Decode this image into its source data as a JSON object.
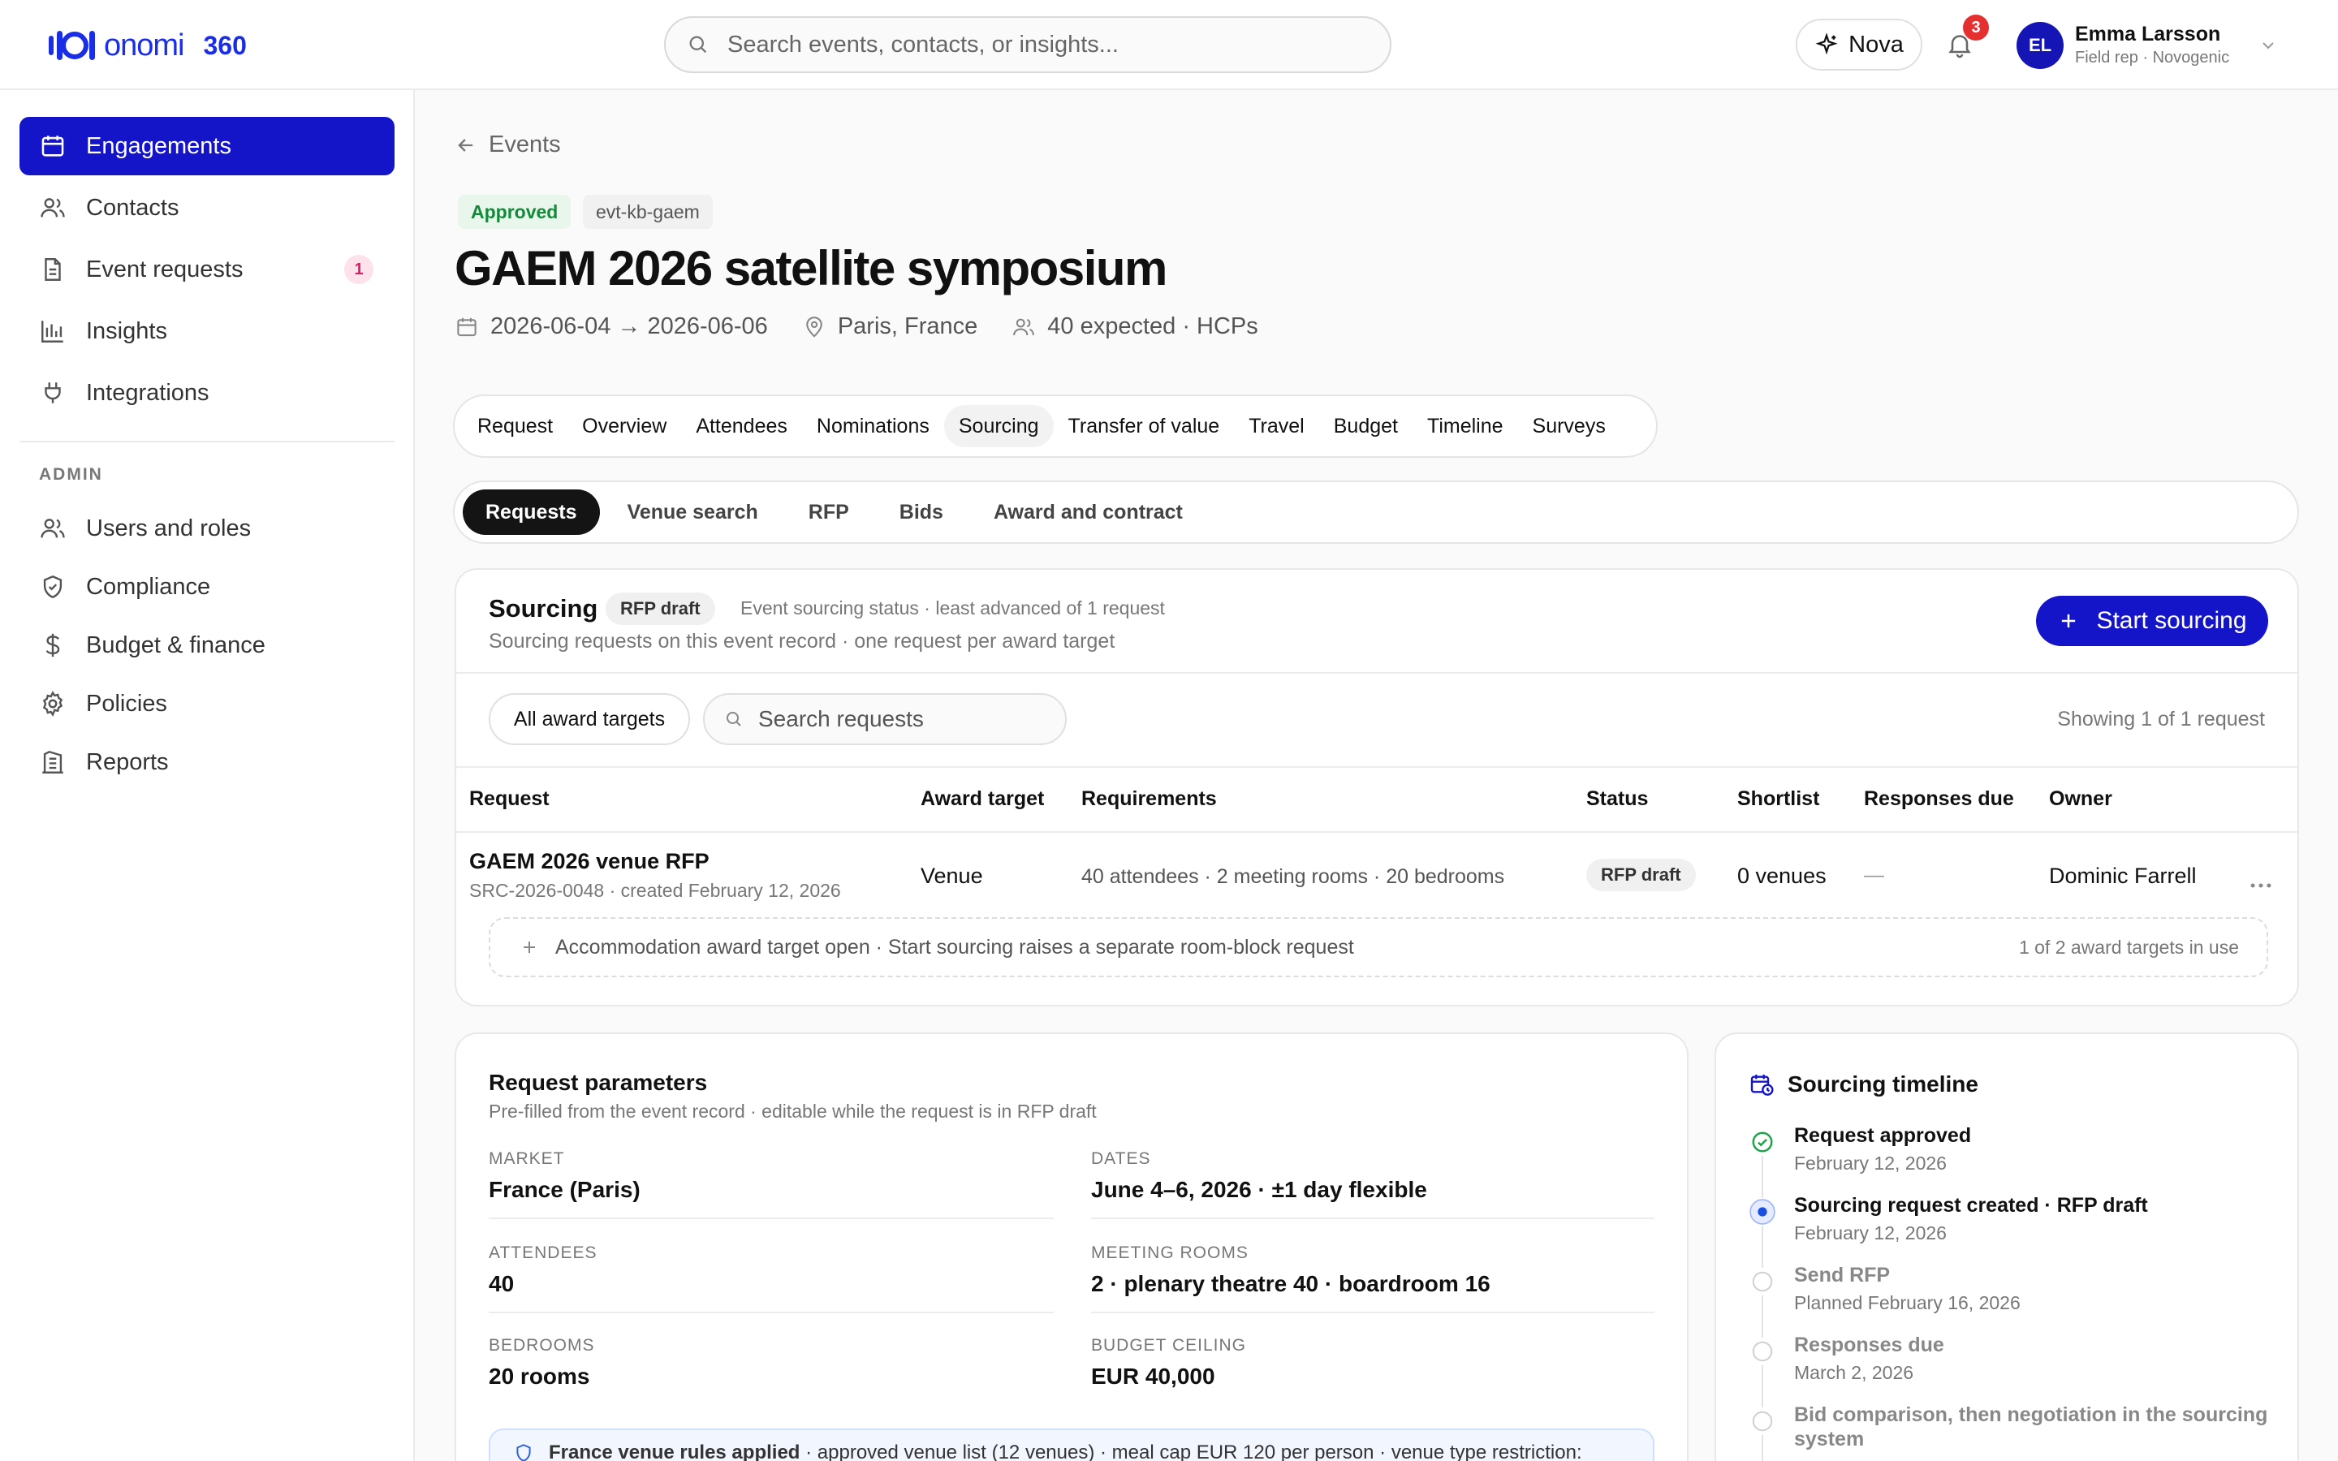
{
  "brand": {
    "name": "onomi",
    "suffix": "360",
    "accent": "#1414c8"
  },
  "search": {
    "placeholder": "Search events, contacts, or insights..."
  },
  "header": {
    "nova_label": "Nova",
    "notifications_count": "3",
    "user": {
      "initials": "EL",
      "name": "Emma Larsson",
      "role": "Field rep · Novogenic"
    }
  },
  "sidebar": {
    "items": [
      {
        "label": "Engagements",
        "icon": "calendar-icon",
        "active": true
      },
      {
        "label": "Contacts",
        "icon": "users-icon"
      },
      {
        "label": "Event requests",
        "icon": "document-icon",
        "badge": "1"
      },
      {
        "label": "Insights",
        "icon": "bar-chart-icon"
      },
      {
        "label": "Integrations",
        "icon": "plug-icon"
      }
    ],
    "admin_label": "ADMIN",
    "admin_items": [
      {
        "label": "Users and roles",
        "icon": "users-icon"
      },
      {
        "label": "Compliance",
        "icon": "shield-icon"
      },
      {
        "label": "Budget & finance",
        "icon": "dollar-icon"
      },
      {
        "label": "Policies",
        "icon": "gear-icon"
      },
      {
        "label": "Reports",
        "icon": "report-icon"
      }
    ]
  },
  "breadcrumb": {
    "label": "Events"
  },
  "event": {
    "status": "Approved",
    "id": "evt-kb-gaem",
    "title": "GAEM 2026 satellite symposium",
    "dates": "2026-06-04 → 2026-06-06",
    "location": "Paris, France",
    "audience": "40 expected · HCPs"
  },
  "tabs": [
    "Request",
    "Overview",
    "Attendees",
    "Nominations",
    "Sourcing",
    "Transfer of value",
    "Travel",
    "Budget",
    "Timeline",
    "Surveys"
  ],
  "active_tab": "Sourcing",
  "subtabs": [
    "Requests",
    "Venue search",
    "RFP",
    "Bids",
    "Award and contract"
  ],
  "active_subtab": "Requests",
  "sourcing": {
    "title": "Sourcing",
    "status_pill": "RFP draft",
    "status_note": "Event sourcing status · least advanced of 1 request",
    "subtitle": "Sourcing requests on this event record · one request per award target",
    "start_button": "Start sourcing",
    "filter_label": "All award targets",
    "search_placeholder": "Search requests",
    "showing": "Showing 1 of 1 request",
    "columns": [
      "Request",
      "Award target",
      "Requirements",
      "Status",
      "Shortlist",
      "Responses due",
      "Owner"
    ],
    "rows": [
      {
        "name": "GAEM 2026 venue RFP",
        "meta": "SRC-2026-0048 · created February 12, 2026",
        "award_target": "Venue",
        "requirements": "40 attendees · 2 meeting rooms · 20 bedrooms",
        "status": "RFP draft",
        "shortlist": "0 venues",
        "responses_due": "—",
        "owner": "Dominic Farrell"
      }
    ],
    "accommodation_note": "Accommodation award target open · Start sourcing raises a separate room-block request",
    "award_targets_in_use": "1 of 2 award targets in use"
  },
  "parameters": {
    "title": "Request parameters",
    "subtitle": "Pre-filled from the event record · editable while the request is in RFP draft",
    "fields": [
      {
        "label": "MARKET",
        "value": "France (Paris)"
      },
      {
        "label": "DATES",
        "value": "June 4–6, 2026 · ±1 day flexible"
      },
      {
        "label": "ATTENDEES",
        "value": "40"
      },
      {
        "label": "MEETING ROOMS",
        "value": "2 · plenary theatre 40 · boardroom 16"
      },
      {
        "label": "BEDROOMS",
        "value": "20 rooms"
      },
      {
        "label": "BUDGET CEILING",
        "value": "EUR 40,000"
      }
    ],
    "rules_bold": "France venue rules applied",
    "rules_text": " · approved venue list (12 venues) · meal cap EUR 120 per person · venue type restriction:"
  },
  "timeline": {
    "title": "Sourcing timeline",
    "items": [
      {
        "name": "Request approved",
        "date": "February 12, 2026",
        "state": "done"
      },
      {
        "name": "Sourcing request created · RFP draft",
        "date": "February 12, 2026",
        "state": "current"
      },
      {
        "name": "Send RFP",
        "date": "Planned February 16, 2026",
        "state": "future"
      },
      {
        "name": "Responses due",
        "date": "March 2, 2026",
        "state": "future"
      },
      {
        "name": "Bid comparison, then negotiation in the sourcing system",
        "date": "",
        "state": "future"
      }
    ]
  }
}
